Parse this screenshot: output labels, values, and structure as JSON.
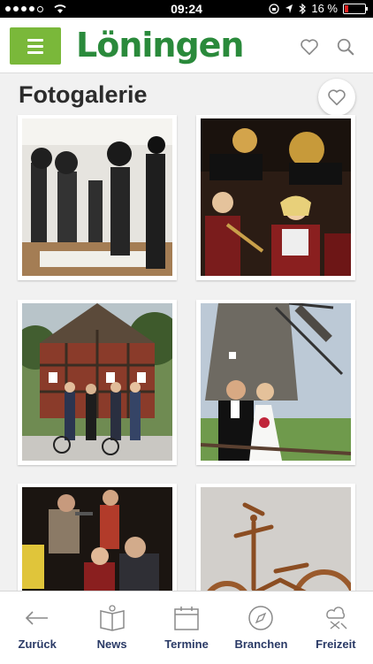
{
  "status_bar": {
    "time": "09:24",
    "battery": "16 %"
  },
  "header": {
    "menu_icon": "hamburger-icon",
    "logo_text": "Löningen",
    "favorite_icon": "heart-icon",
    "search_icon": "search-icon",
    "brand_color": "#7ab83a"
  },
  "page": {
    "title": "Fotogalerie",
    "favorite_icon": "heart-icon"
  },
  "gallery": [
    {
      "subject": "projector-museum-photo"
    },
    {
      "subject": "brass-band-concert-photo"
    },
    {
      "subject": "half-timbered-house-cyclists-photo"
    },
    {
      "subject": "windmill-wedding-photo"
    },
    {
      "subject": "folk-musicians-photo"
    },
    {
      "subject": "wooden-bicycle-photo"
    }
  ],
  "bottom_nav": {
    "items": [
      {
        "label": "Zurück",
        "icon": "back-arrow-icon"
      },
      {
        "label": "News",
        "icon": "news-icon"
      },
      {
        "label": "Termine",
        "icon": "calendar-icon"
      },
      {
        "label": "Branchen",
        "icon": "compass-icon"
      },
      {
        "label": "Freizeit",
        "icon": "leisure-icon"
      }
    ],
    "label_color": "#2a3a66"
  }
}
